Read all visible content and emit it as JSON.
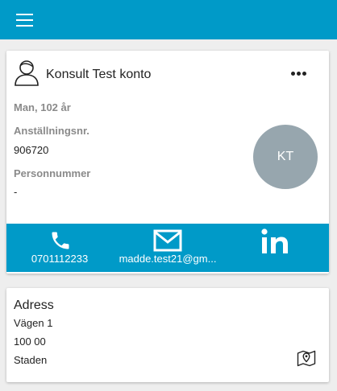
{
  "header": {
    "menu_icon": "hamburger-menu-icon",
    "color": "#009ac8"
  },
  "profile": {
    "person_icon": "person-outline-icon",
    "name": "Konsult Test konto",
    "more_icon": "more-horizontal-icon",
    "gender_age": "Man, 102 år",
    "employee_number_label": "Anställningsnr.",
    "employee_number": "906720",
    "personal_number_label": "Personnummer",
    "personal_number": "-",
    "avatar_initials": "KT",
    "avatar_color": "#97a6ae"
  },
  "contact": {
    "phone": {
      "icon": "phone-icon",
      "label": "0701112233"
    },
    "email": {
      "icon": "email-icon",
      "label": "madde.test21@gm..."
    },
    "linkedin": {
      "icon": "linkedin-icon",
      "label": ""
    }
  },
  "address": {
    "title": "Adress",
    "street": "Vägen 1",
    "postal_code": "100 00",
    "city": "Staden",
    "map_icon": "map-pin-icon"
  }
}
